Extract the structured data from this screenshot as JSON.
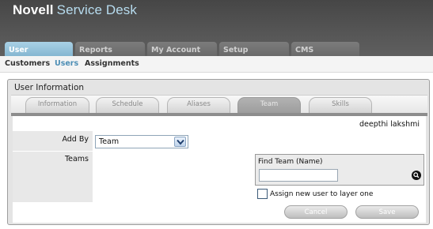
{
  "app": {
    "brand_primary": "Novell",
    "brand_secondary": "Service Desk"
  },
  "nav": {
    "tabs": [
      {
        "label": "User",
        "active": true
      },
      {
        "label": "Reports",
        "active": false
      },
      {
        "label": "My Account",
        "active": false
      },
      {
        "label": "Setup",
        "active": false
      },
      {
        "label": "CMS",
        "active": false
      }
    ]
  },
  "subnav": {
    "items": [
      {
        "label": "Customers"
      },
      {
        "label": "Users",
        "active": true
      },
      {
        "label": "Assignments"
      }
    ]
  },
  "panel": {
    "title": "User Information",
    "tabs": [
      {
        "label": "Information"
      },
      {
        "label": "Schedule"
      },
      {
        "label": "Aliases"
      },
      {
        "label": "Team",
        "active": true
      },
      {
        "label": "Skills"
      }
    ]
  },
  "form": {
    "user_name": "deepthi lakshmi",
    "add_by_label": "Add By",
    "add_by_value": "Team",
    "teams_label": "Teams",
    "find_team_label": "Find Team (Name)",
    "find_team_value": "",
    "assign_checkbox_label": "Assign new user to layer one",
    "assign_checked": false
  },
  "buttons": {
    "cancel": "Cancel",
    "save": "Save"
  },
  "colors": {
    "active_tab": "#85b7d1",
    "subnav_active": "#4d8eb5",
    "brand_secondary": "#b7dcef"
  }
}
